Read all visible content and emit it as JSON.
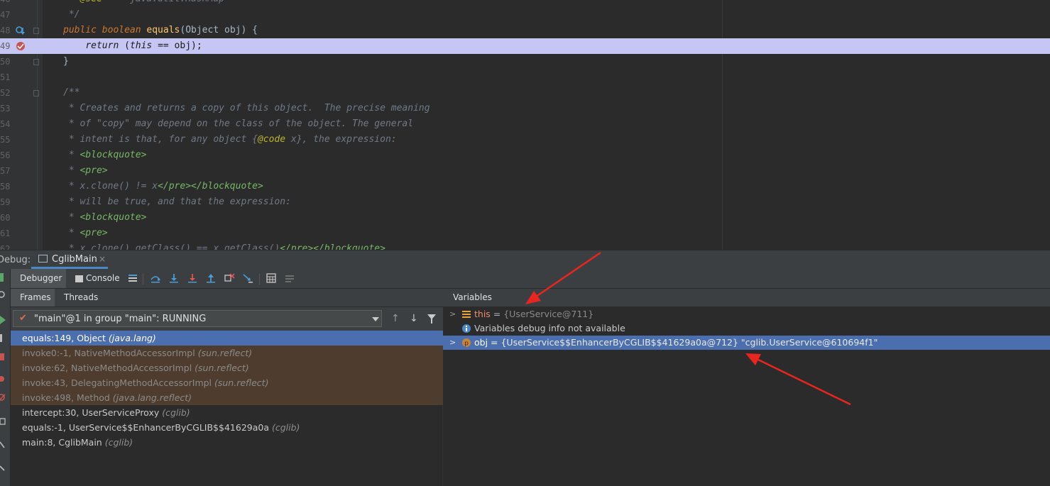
{
  "editor": {
    "lines": [
      {
        "num": "47",
        "text_html": "<span class=\"cmg\"> */</span>"
      },
      {
        "num": "48",
        "text_html": "<span class=\"kw\">public boolean </span><span class=\"fn\">equals</span>(Object obj) {"
      },
      {
        "num": "49",
        "text_html": "    <span class=\"kw\">return </span>(<span class=\"kw\">this</span> == obj);"
      },
      {
        "num": "50",
        "text_html": "}"
      },
      {
        "num": "51",
        "text_html": ""
      },
      {
        "num": "52",
        "text_html": "<span class=\"cmg\">/**</span>"
      },
      {
        "num": "53",
        "text_html": "<span class=\"cmg\"> * Creates and returns a copy of this object.  The precise meaning</span>"
      },
      {
        "num": "54",
        "text_html": "<span class=\"cmg\"> * of \"copy\" may depend on the class of the object. The general</span>"
      },
      {
        "num": "55",
        "text_html": "<span class=\"cmg\"> * intent is that, for any object {</span><span class=\"ann\">@code</span><span class=\"cmg\"> x}, the expression:</span>"
      },
      {
        "num": "56",
        "text_html": "<span class=\"cmg\"> * </span><span class=\"tag\">&lt;blockquote&gt;</span>"
      },
      {
        "num": "57",
        "text_html": "<span class=\"cmg\"> * </span><span class=\"tag\">&lt;pre&gt;</span>"
      },
      {
        "num": "58",
        "text_html": "<span class=\"cmg\"> * x.clone() != x</span><span class=\"tag\">&lt;/pre&gt;&lt;/blockquote&gt;</span>"
      },
      {
        "num": "59",
        "text_html": "<span class=\"cmg\"> * will be true, and that the expression:</span>"
      },
      {
        "num": "60",
        "text_html": "<span class=\"cmg\"> * </span><span class=\"tag\">&lt;blockquote&gt;</span>"
      },
      {
        "num": "61",
        "text_html": "<span class=\"cmg\"> * </span><span class=\"tag\">&lt;pre&gt;</span>"
      },
      {
        "num": "62",
        "text_html": "<span class=\"cmg\"> * x.clone().getClass() == x.getClass()</span><span class=\"tag\">&lt;/pre&gt;&lt;/blockquote&gt;</span>"
      }
    ],
    "top_partial_html": "<span class=\"cmg\"> * </span><span class=\"ann\">@see</span><span class=\"cmg\">     java.util.HashMap</span>",
    "top_partial_num": "46"
  },
  "debug_bar": {
    "label": "Debug:",
    "tab_label": "CglibMain",
    "tab_close": "×"
  },
  "toolbar": {
    "debugger_tab": "Debugger",
    "console_tab": "Console"
  },
  "frames": {
    "tab_frames": "Frames",
    "tab_threads": "Threads",
    "thread_label": "\"main\"@1 in group \"main\": RUNNING",
    "items": [
      {
        "method": "equals:149, Object ",
        "pkg": "(java.lang)",
        "kind": "sel"
      },
      {
        "method": "invoke0:-1, NativeMethodAccessorImpl ",
        "pkg": "(sun.reflect)",
        "kind": "lib"
      },
      {
        "method": "invoke:62, NativeMethodAccessorImpl ",
        "pkg": "(sun.reflect)",
        "kind": "lib"
      },
      {
        "method": "invoke:43, DelegatingMethodAccessorImpl ",
        "pkg": "(sun.reflect)",
        "kind": "lib"
      },
      {
        "method": "invoke:498, Method ",
        "pkg": "(java.lang.reflect)",
        "kind": "lib"
      },
      {
        "method": "intercept:30, UserServiceProxy ",
        "pkg": "(cglib)",
        "kind": ""
      },
      {
        "method": "equals:-1, UserService$$EnhancerByCGLIB$$41629a0a ",
        "pkg": "(cglib)",
        "kind": ""
      },
      {
        "method": "main:8, CglibMain ",
        "pkg": "(cglib)",
        "kind": ""
      }
    ]
  },
  "variables": {
    "title": "Variables",
    "this_name": "this",
    "this_eq": " = ",
    "this_val": "{UserService@711}",
    "info": "Variables debug info not available",
    "obj_name": "obj",
    "obj_eq": " = ",
    "obj_val": "{UserService$$EnhancerByCGLIB$$41629a0a@712} ",
    "obj_str": "\"cglib.UserService@610694f1\""
  },
  "colors": {
    "accent": "#4b6eaf",
    "highlight_line": "#c6c6f5",
    "arrow": "#e8261f"
  }
}
